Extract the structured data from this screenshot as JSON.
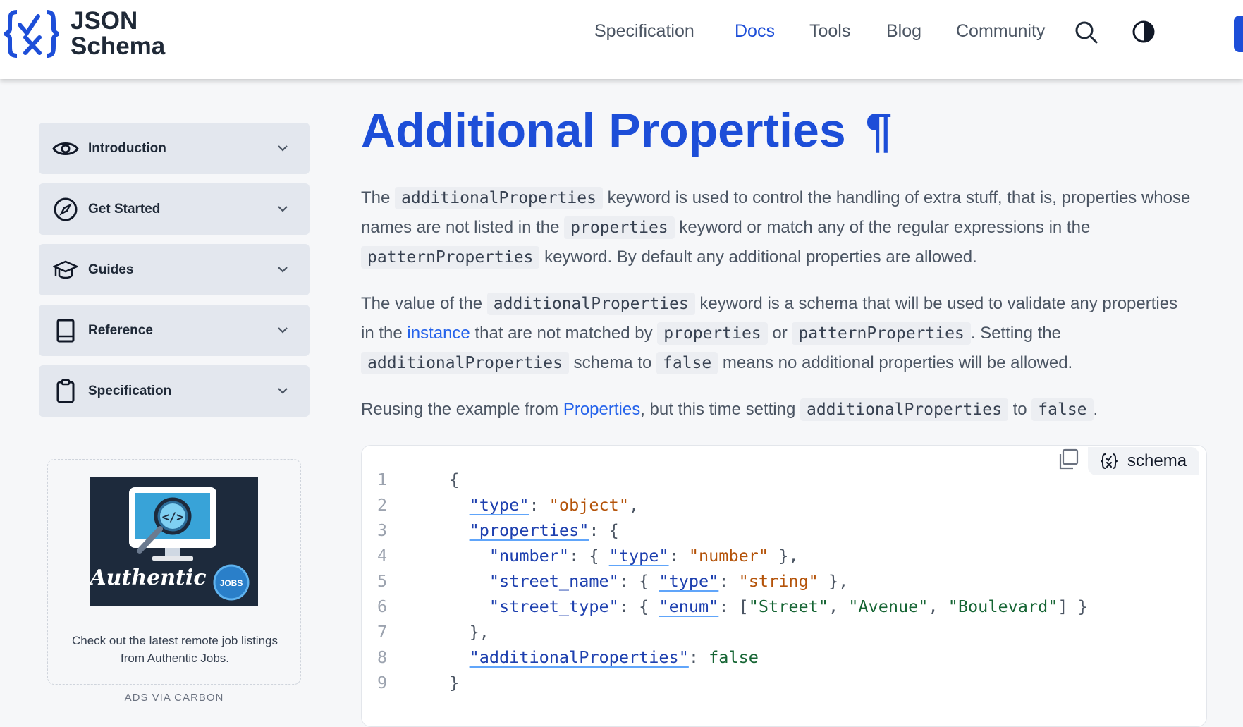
{
  "header": {
    "logo_line1": "JSON",
    "logo_line2": "Schema",
    "nav": [
      "Specification",
      "Docs",
      "Tools",
      "Blog",
      "Community"
    ],
    "active_nav": "Docs"
  },
  "sidebar": {
    "items": [
      {
        "label": "Introduction",
        "icon": "eye-icon"
      },
      {
        "label": "Get Started",
        "icon": "compass-icon"
      },
      {
        "label": "Guides",
        "icon": "graduation-cap-icon"
      },
      {
        "label": "Reference",
        "icon": "book-icon"
      },
      {
        "label": "Specification",
        "icon": "clipboard-icon"
      }
    ],
    "ad": {
      "text": "Check out the latest remote job listings from Authentic Jobs.",
      "footer": "ADS VIA CARBON",
      "brand": "Authentic",
      "badge": "JOBS"
    }
  },
  "main": {
    "title": "Additional Properties",
    "anchor": "¶",
    "p1": {
      "t1": "The ",
      "c1": "additionalProperties",
      "t2": " keyword is used to control the handling of extra stuff, that is, properties whose names are not listed in the ",
      "c2": "properties",
      "t3": " keyword or match any of the regular expressions in the ",
      "c3": "patternProperties",
      "t4": " keyword. By default any additional properties are allowed."
    },
    "p2": {
      "t1": "The value of the ",
      "c1": "additionalProperties",
      "t2": " keyword is a schema that will be used to validate any properties in the ",
      "link": "instance",
      "t3": " that are not matched by ",
      "c2": "properties",
      "t4": " or ",
      "c3": "patternProperties",
      "t5": ". Setting the ",
      "c4": "additionalProperties",
      "t6": " schema to ",
      "c5": "false",
      "t7": " means no additional properties will be allowed."
    },
    "p3": {
      "t1": "Reusing the example from ",
      "link": "Properties",
      "t2": ", but this time setting ",
      "c1": "additionalProperties",
      "t3": " to ",
      "c2": "false",
      "t4": "."
    },
    "code_tag": "schema",
    "line_numbers": [
      "1",
      "2",
      "3",
      "4",
      "5",
      "6",
      "7",
      "8",
      "9"
    ],
    "code": {
      "l1": "{",
      "type_key": "\"type\"",
      "type_val": "\"object\"",
      "props_key": "\"properties\"",
      "number_key": "\"number\"",
      "number_type_val": "\"number\"",
      "street_name_key": "\"street_name\"",
      "string_val": "\"string\"",
      "street_type_key": "\"street_type\"",
      "enum_key": "\"enum\"",
      "enum_v1": "\"Street\"",
      "enum_v2": "\"Avenue\"",
      "enum_v3": "\"Boulevard\"",
      "add_key": "\"additionalProperties\"",
      "false_val": "false",
      "close": "}"
    }
  }
}
